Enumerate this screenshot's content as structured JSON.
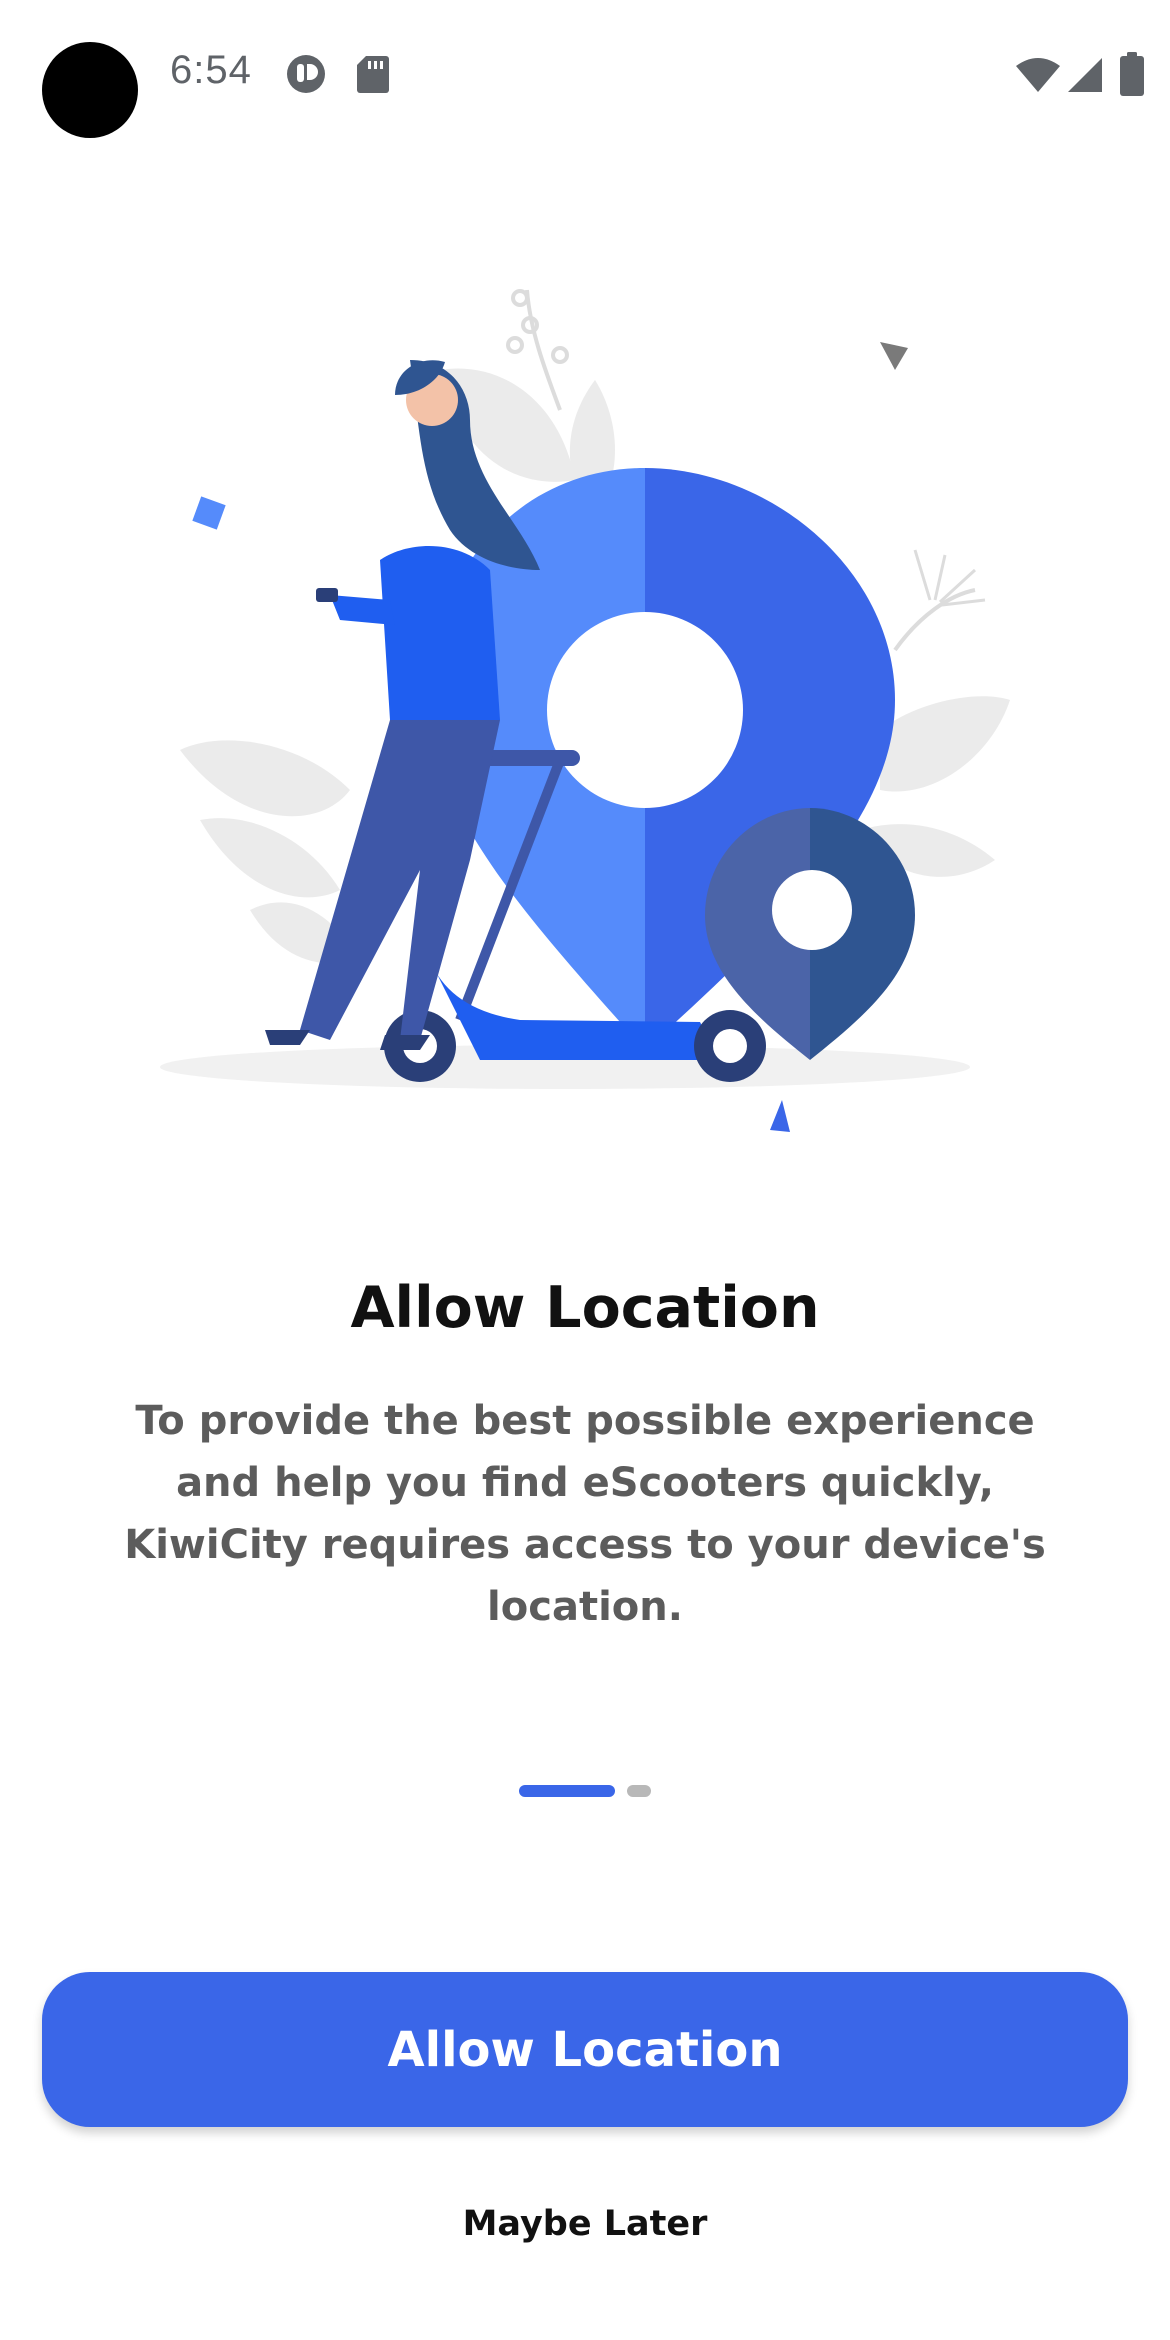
{
  "status_bar": {
    "time": "6:54",
    "icons": [
      "camera-cutout",
      "app-notification-icon",
      "sd-card-icon",
      "wifi-icon",
      "cellular-signal-icon",
      "battery-icon"
    ]
  },
  "onboarding": {
    "title": "Allow Location",
    "description": "To provide the best possible experience and help you find eScooters quickly, KiwiCity requires access to your device's location.",
    "page_indicator": {
      "current": 1,
      "total": 2
    }
  },
  "actions": {
    "primary_label": "Allow Location",
    "secondary_label": "Maybe Later"
  },
  "colors": {
    "accent": "#3a66e8",
    "pin_light": "#558bfb",
    "pin_dark": "#3a66e8",
    "small_pin_light": "#4b64a8",
    "small_pin_dark": "#2f5591",
    "leaf_gray": "#ebebeb",
    "text_primary": "#111111",
    "text_secondary": "#5c5c5c"
  }
}
